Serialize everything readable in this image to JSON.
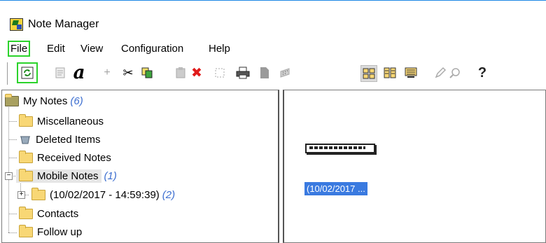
{
  "window": {
    "title": "Note Manager"
  },
  "menu": [
    {
      "label": "File",
      "highlighted": true
    },
    {
      "label": "Edit"
    },
    {
      "label": "View"
    },
    {
      "label": "Configuration"
    },
    {
      "label": "Help"
    }
  ],
  "toolbar": {
    "icons": [
      "refresh-icon",
      "properties-icon",
      "font-icon",
      "plus-icon",
      "cut-icon",
      "copy-icon",
      "paste-icon",
      "delete-icon",
      "select-icon",
      "print-icon",
      "new-page-icon",
      "calculator-icon",
      "large-icons-view-icon",
      "small-icons-view-icon",
      "list-view-icon",
      "edit-icon",
      "search-icon",
      "help-icon"
    ],
    "glyphs": {
      "font": "a",
      "plus": "+",
      "cut": "✂",
      "delete": "✖",
      "help": "?"
    }
  },
  "tree": {
    "root": {
      "label": "My Notes",
      "count": "(6)"
    },
    "items": [
      {
        "label": "Miscellaneous"
      },
      {
        "label": "Deleted Items"
      },
      {
        "label": "Received Notes"
      },
      {
        "label": "Mobile Notes",
        "count": "(1)",
        "expanded": true
      },
      {
        "label": "(10/02/2017 - 14:59:39)",
        "count": "(2)"
      },
      {
        "label": "Contacts"
      },
      {
        "label": "Follow up"
      }
    ]
  },
  "note_pane": {
    "selected_label": "(10/02/2017 ..."
  },
  "colors": {
    "accent": "#2bd32b",
    "count_text": "#3d6fd0",
    "selection": "#3a7ae0"
  }
}
